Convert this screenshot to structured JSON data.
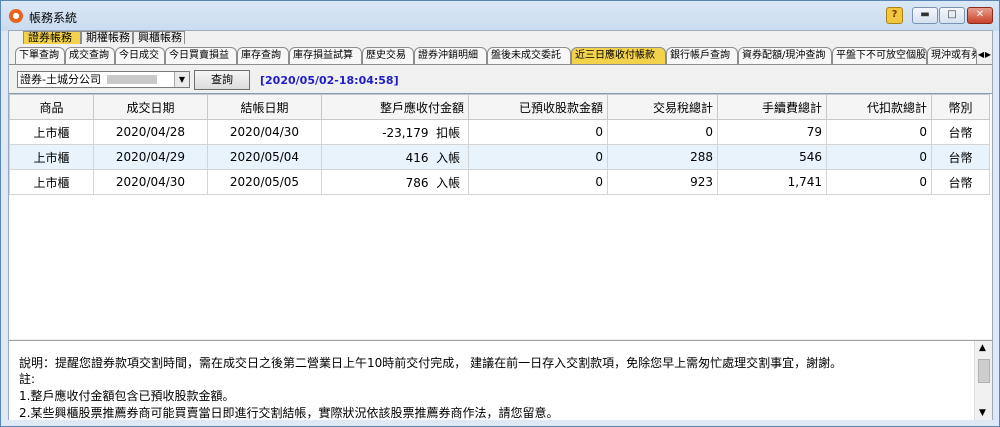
{
  "window": {
    "title": "帳務系統",
    "help_label": "?"
  },
  "top_tabs": [
    {
      "label": "證券帳務",
      "active": true
    },
    {
      "label": "期權帳務",
      "active": false
    },
    {
      "label": "興櫃帳務",
      "active": false
    }
  ],
  "sub_tabs": [
    {
      "label": "下單查詢",
      "active": false
    },
    {
      "label": "成交查詢",
      "active": false
    },
    {
      "label": "今日成交",
      "active": false
    },
    {
      "label": "今日買賣損益",
      "active": false
    },
    {
      "label": "庫存查詢",
      "active": false
    },
    {
      "label": "庫存損益試算",
      "active": false
    },
    {
      "label": "歷史交易",
      "active": false
    },
    {
      "label": "證券沖銷明細",
      "active": false
    },
    {
      "label": "盤後未成交委託",
      "active": false
    },
    {
      "label": "近三日應收付帳款",
      "active": true
    },
    {
      "label": "銀行帳戶查詢",
      "active": false
    },
    {
      "label": "資券配額/現沖查詢",
      "active": false
    },
    {
      "label": "平盤下不可放空個股",
      "active": false
    },
    {
      "label": "現沖或有券配額",
      "active": false
    }
  ],
  "filter": {
    "account": "證券-土城分公司",
    "query_label": "查詢",
    "timestamp": "[2020/05/02-18:04:58]"
  },
  "table": {
    "columns": [
      "商品",
      "成交日期",
      "結帳日期",
      "整戶應收付金額",
      "已預收股款金額",
      "交易稅總計",
      "手續費總計",
      "代扣款總計",
      "幣別"
    ],
    "rows": [
      {
        "product": "上市櫃",
        "trade_date": "2020/04/28",
        "settle_date": "2020/04/30",
        "amount": "-23,179",
        "direction": "扣帳",
        "prepaid": "0",
        "tax": "0",
        "fee": "79",
        "withheld": "0",
        "currency": "台幣",
        "selected": false
      },
      {
        "product": "上市櫃",
        "trade_date": "2020/04/29",
        "settle_date": "2020/05/04",
        "amount": "416",
        "direction": "入帳",
        "prepaid": "0",
        "tax": "288",
        "fee": "546",
        "withheld": "0",
        "currency": "台幣",
        "selected": true
      },
      {
        "product": "上市櫃",
        "trade_date": "2020/04/30",
        "settle_date": "2020/05/05",
        "amount": "786",
        "direction": "入帳",
        "prepaid": "0",
        "tax": "923",
        "fee": "1,741",
        "withheld": "0",
        "currency": "台幣",
        "selected": false
      }
    ]
  },
  "note": {
    "lines": [
      "說明：提醒您證券款項交割時間，需在成交日之後第二營業日上午10時前交付完成， 建議在前一日存入交割款項，免除您早上需匆忙處理交割事宜，謝謝。",
      "註:",
      "1.整戶應收付金額包含已預收股款金額。",
      "2.某些興櫃股票推薦券商可能買賣當日即進行交割結帳，實際狀況依該股票推薦券商作法，請您留意。"
    ]
  }
}
